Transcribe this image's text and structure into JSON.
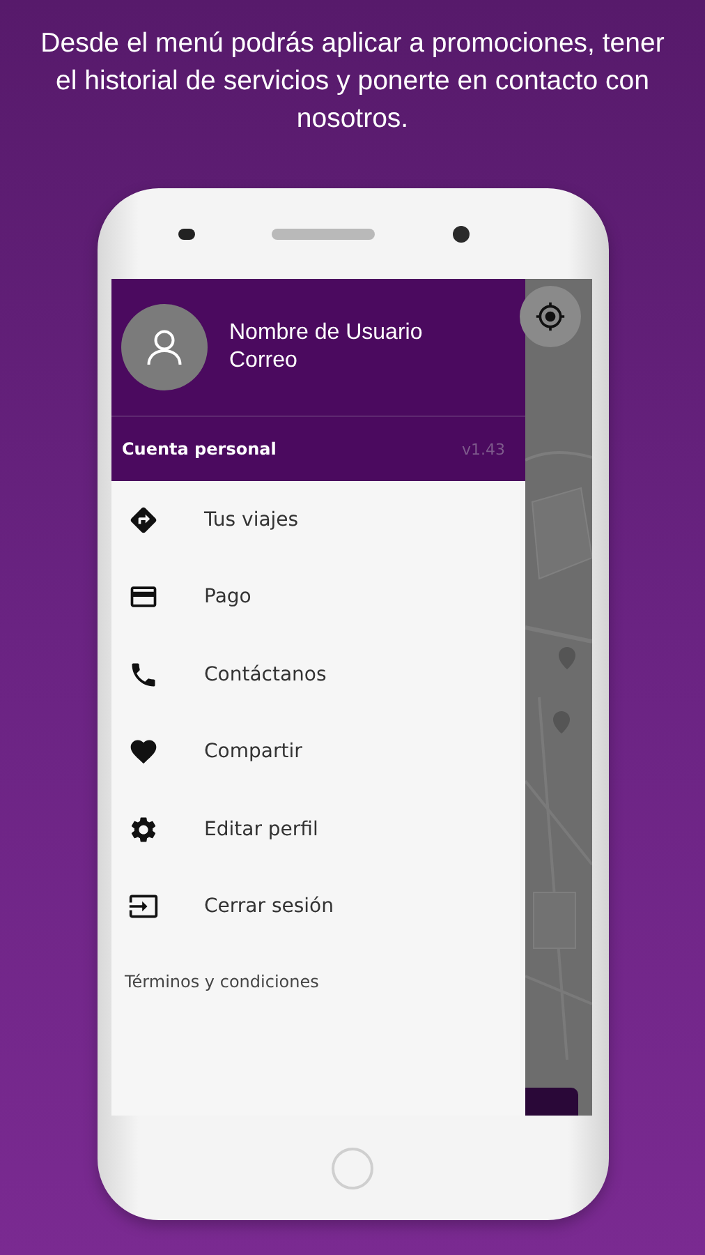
{
  "headline": "Desde el menú podrás aplicar a promociones, tener el historial de servicios y ponerte en contacto con nosotros.",
  "drawer": {
    "user_name": "Nombre de Usuario",
    "user_email": "Correo",
    "account_label": "Cuenta personal",
    "version": "v1.43",
    "items": [
      {
        "label": "Tus viajes"
      },
      {
        "label": "Pago"
      },
      {
        "label": "Contáctanos"
      },
      {
        "label": "Compartir"
      },
      {
        "label": "Editar perfil"
      },
      {
        "label": "Cerrar sesión"
      }
    ],
    "footer_link": "Términos y condiciones"
  }
}
